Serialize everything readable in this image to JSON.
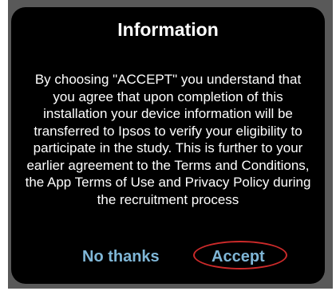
{
  "dialog": {
    "title": "Information",
    "message": "By choosing \"ACCEPT\" you understand that you agree that upon completion of this installation your device information will be transferred to Ipsos to verify your eligibility to participate in the study. This is further to your earlier agreement to the Terms and Conditions, the App Terms of Use and Privacy Policy during the recruitment process",
    "buttons": {
      "decline_label": "No thanks",
      "accept_label": "Accept"
    }
  },
  "colors": {
    "dialog_background": "#000000",
    "text": "#ffffff",
    "button_text": "#7fb6d6",
    "annotation_circle": "#cc2a2a"
  }
}
